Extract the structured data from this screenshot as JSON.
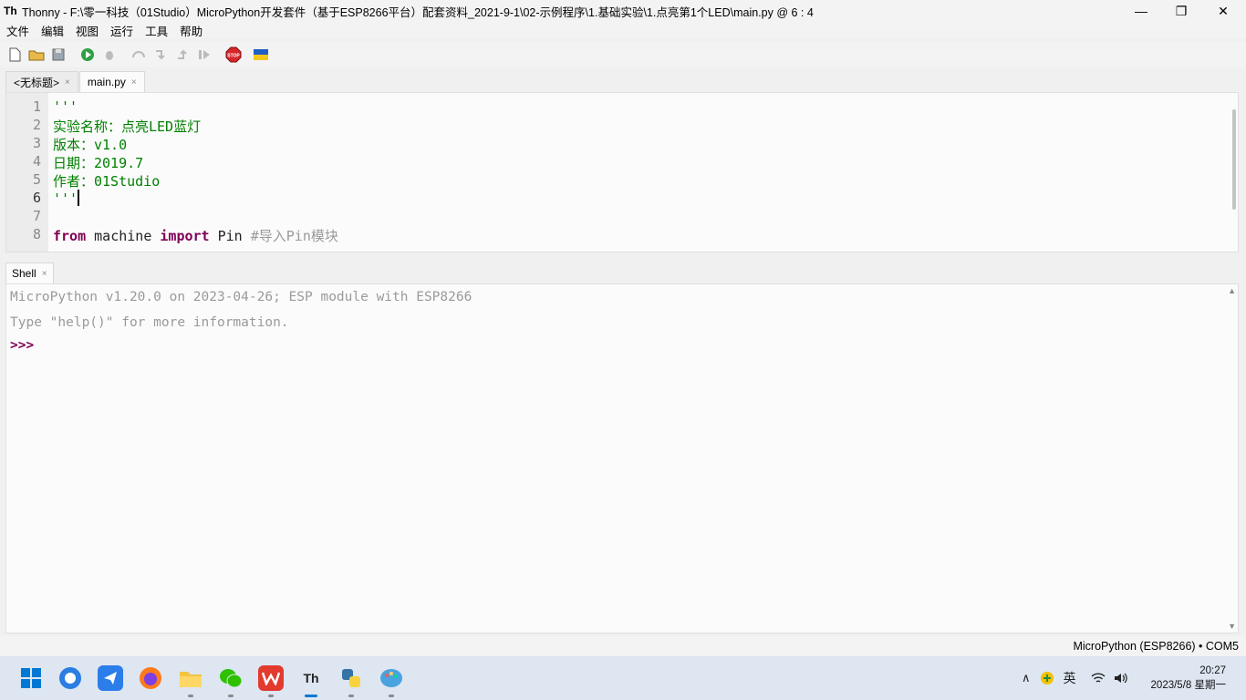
{
  "window": {
    "title": "Thonny  -  F:\\零一科技（01Studio）MicroPython开发套件（基于ESP8266平台）配套资料_2021-9-1\\02-示例程序\\1.基础实验\\1.点亮第1个LED\\main.py  @  6 : 4",
    "minimize": "—",
    "restore": "❐",
    "close": "✕"
  },
  "menu": [
    "文件",
    "编辑",
    "视图",
    "运行",
    "工具",
    "帮助"
  ],
  "toolbar": {
    "stop_label": "STOP"
  },
  "tabs": [
    {
      "label": "<无标题>",
      "close": "×"
    },
    {
      "label": "main.py",
      "close": "×"
    }
  ],
  "editor": {
    "line_numbers": [
      "1",
      "2",
      "3",
      "4",
      "5",
      "6",
      "7",
      "8"
    ],
    "lines": {
      "l1": "'''",
      "l2": "实验名称：点亮LED蓝灯",
      "l3": "版本：v1.0",
      "l4": "日期：2019.7",
      "l5": "作者：01Studio",
      "l6": "'''",
      "l8_kw1": "from",
      "l8_mod": " machine ",
      "l8_kw2": "import",
      "l8_name": " Pin ",
      "l8_comment": "#导入Pin模块"
    }
  },
  "shell": {
    "tab_label": "Shell",
    "close": "×",
    "banner": "MicroPython v1.20.0 on 2023-04-26; ESP module with ESP8266",
    "help": "Type \"help()\" for more information.",
    "prompt": ">>>"
  },
  "status": {
    "interpreter": "MicroPython (ESP8266)  •  COM5"
  },
  "taskbar": {
    "ime": "英",
    "time": "20:27",
    "date": "2023/5/8 星期一"
  },
  "colors": {
    "string": "#008000",
    "keyword": "#7f0055",
    "comment": "#9a9a9a"
  }
}
